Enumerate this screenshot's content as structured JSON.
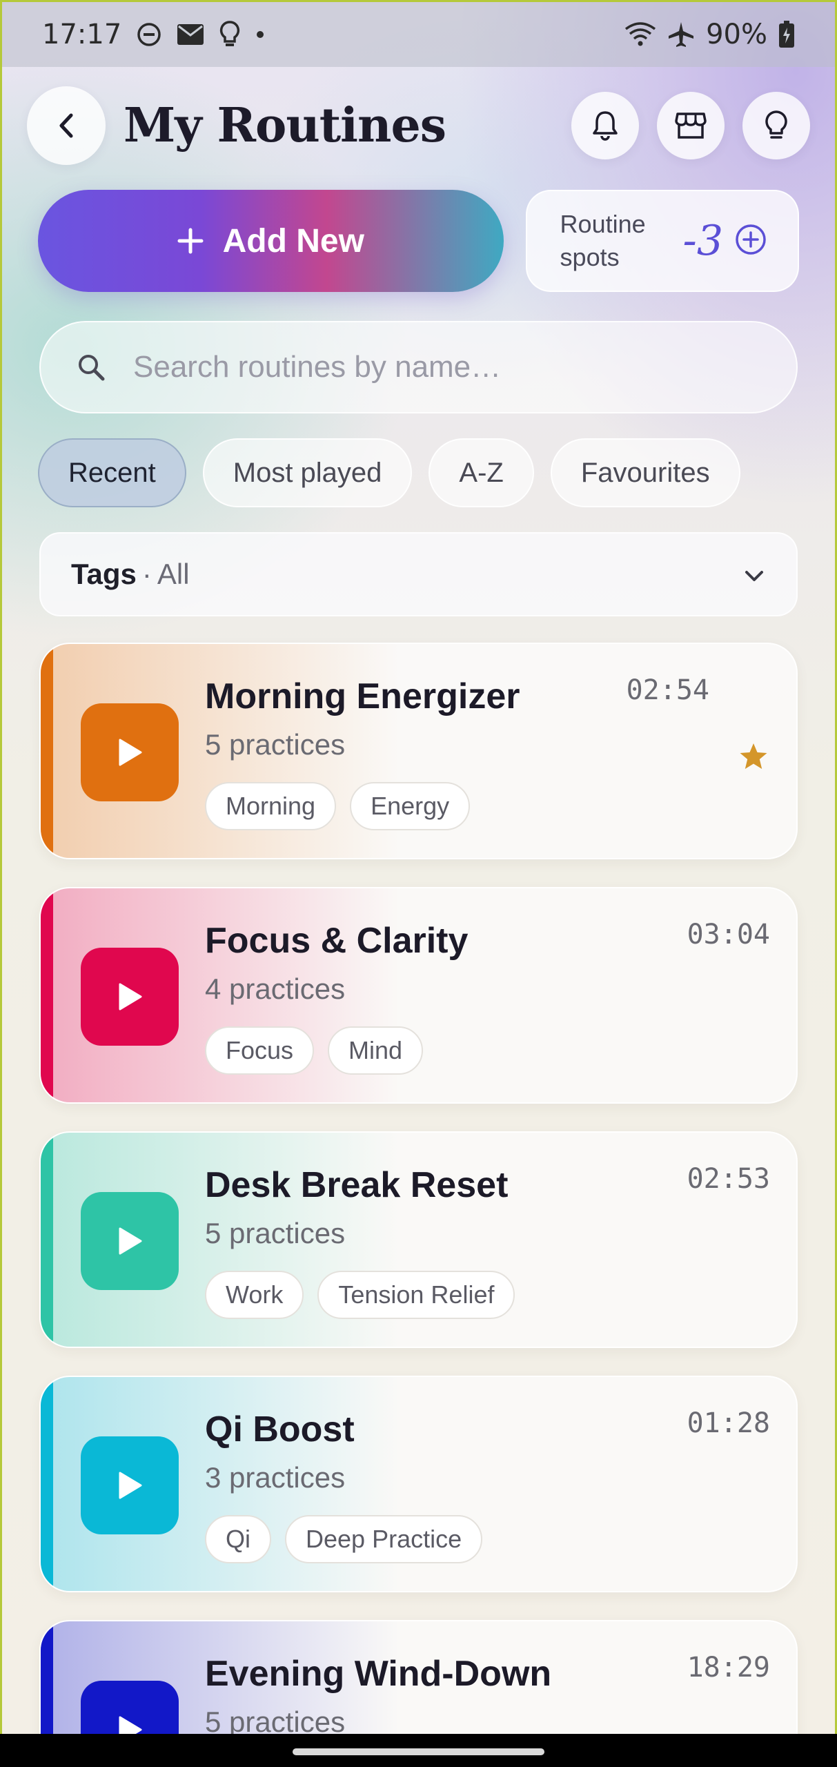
{
  "status_bar": {
    "time": "17:17",
    "battery": "90%",
    "left_icons": [
      "do-not-disturb-icon",
      "mail-icon",
      "lightbulb-icon",
      "dot-icon"
    ],
    "right_icons": [
      "wifi-icon",
      "airplane-icon",
      "battery-charging-icon"
    ]
  },
  "header": {
    "title": "My Routines",
    "actions": [
      "bell-icon",
      "store-icon",
      "lightbulb-icon"
    ]
  },
  "add_new": {
    "label": "Add New"
  },
  "routine_spots": {
    "label": "Routine spots",
    "value": "-3"
  },
  "search": {
    "placeholder": "Search routines by name…",
    "value": ""
  },
  "filters": [
    {
      "label": "Recent",
      "active": true
    },
    {
      "label": "Most played",
      "active": false
    },
    {
      "label": "A-Z",
      "active": false
    },
    {
      "label": "Favourites",
      "active": false
    }
  ],
  "tags_filter": {
    "label": "Tags",
    "separator": "·",
    "value": "All"
  },
  "routines": [
    {
      "title": "Morning Energizer",
      "subtitle": "5 practices",
      "tags": [
        "Morning",
        "Energy"
      ],
      "duration": "02:54",
      "favourite": true,
      "color": "#e07010"
    },
    {
      "title": "Focus & Clarity",
      "subtitle": "4 practices",
      "tags": [
        "Focus",
        "Mind"
      ],
      "duration": "03:04",
      "favourite": false,
      "color": "#e0074e"
    },
    {
      "title": "Desk Break Reset",
      "subtitle": "5 practices",
      "tags": [
        "Work",
        "Tension Relief"
      ],
      "duration": "02:53",
      "favourite": false,
      "color": "#2ec4a6"
    },
    {
      "title": "Qi Boost",
      "subtitle": "3 practices",
      "tags": [
        "Qi",
        "Deep Practice"
      ],
      "duration": "01:28",
      "favourite": false,
      "color": "#0ab8d6"
    },
    {
      "title": "Evening Wind-Down",
      "subtitle": "5 practices",
      "tags": [],
      "duration": "18:29",
      "favourite": false,
      "color": "#1218c8"
    }
  ],
  "colors": {
    "accent": "#5b4fd6",
    "star": "#d4962a"
  }
}
